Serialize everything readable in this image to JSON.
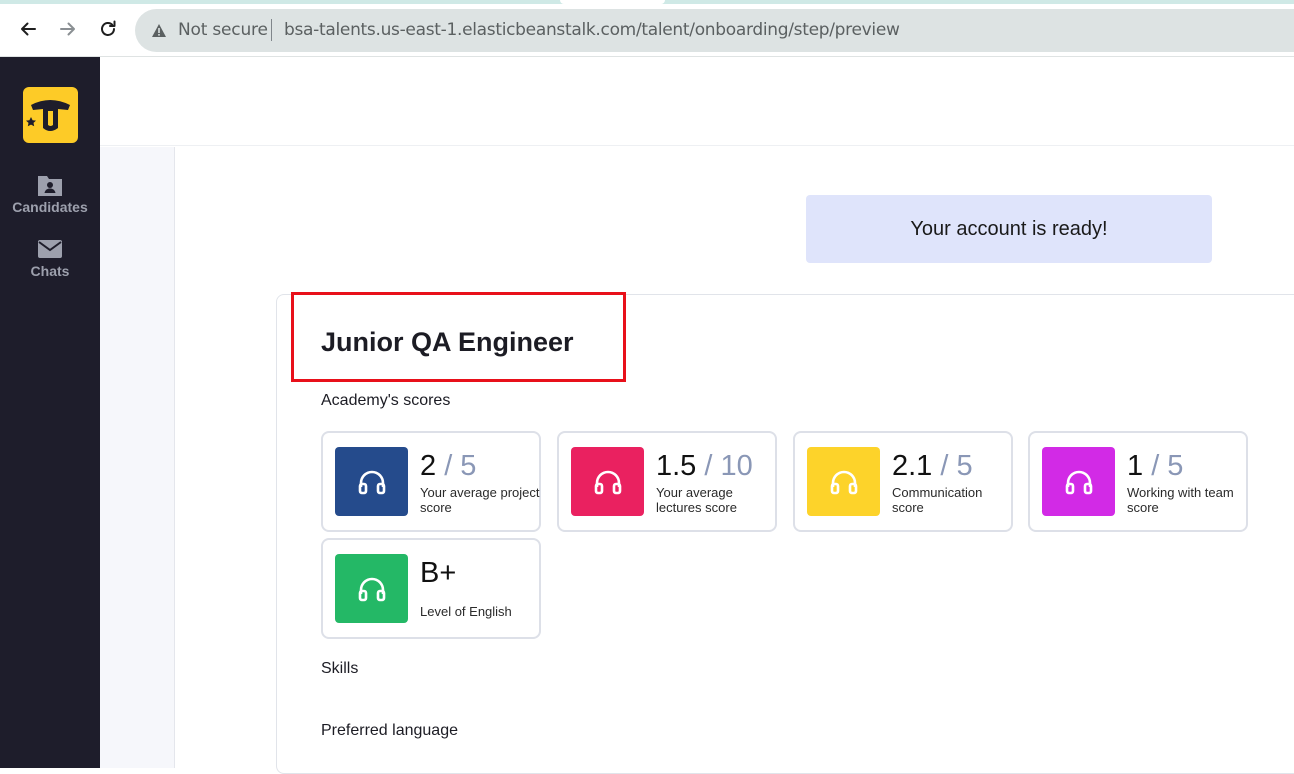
{
  "browser": {
    "security_label": "Not secure",
    "url": "bsa-talents.us-east-1.elasticbeanstalk.com/talent/onboarding/step/preview"
  },
  "sidebar": {
    "items": [
      {
        "label": "Candidates",
        "icon": "folder-user-icon"
      },
      {
        "label": "Chats",
        "icon": "envelope-icon"
      }
    ]
  },
  "banner": {
    "text": "Your account is ready!"
  },
  "profile": {
    "title": "Junior QA Engineer",
    "academy_label": "Academy's scores",
    "skills_label": "Skills",
    "preferred_language_label": "Preferred language",
    "scores": [
      {
        "value": "2",
        "max": " / 5",
        "desc": "Your average project score",
        "color": "#254b8c",
        "icon": "headphones-icon"
      },
      {
        "value": "1.5",
        "max": " / 10",
        "desc": "Your average lectures score",
        "color": "#ea2160",
        "icon": "headphones-icon"
      },
      {
        "value": "2.1",
        "max": " / 5",
        "desc": "Communication score",
        "color": "#fdd32a",
        "icon": "headphones-icon"
      },
      {
        "value": "1",
        "max": " / 5",
        "desc": "Working with team score",
        "color": "#d22ae6",
        "icon": "headphones-icon"
      },
      {
        "value": "B+",
        "max": "",
        "desc": "Level of English",
        "color": "#24b866",
        "icon": "headphones-icon"
      }
    ]
  }
}
